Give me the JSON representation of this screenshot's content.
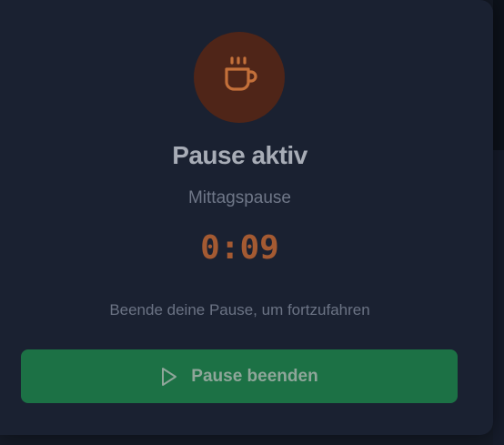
{
  "colors": {
    "modal_bg": "#1a2131",
    "icon_circle_bg": "#4f2518",
    "icon_stroke": "#c4703a",
    "timer": "#a45a32",
    "button_bg": "#1c7145"
  },
  "break_modal": {
    "icon": "coffee-cup-icon",
    "title": "Pause aktiv",
    "break_type": "Mittagspause",
    "timer": "0:09",
    "hint": "Beende deine Pause, um fortzufahren",
    "end_button": {
      "icon": "play-icon",
      "label": "Pause beenden"
    }
  }
}
